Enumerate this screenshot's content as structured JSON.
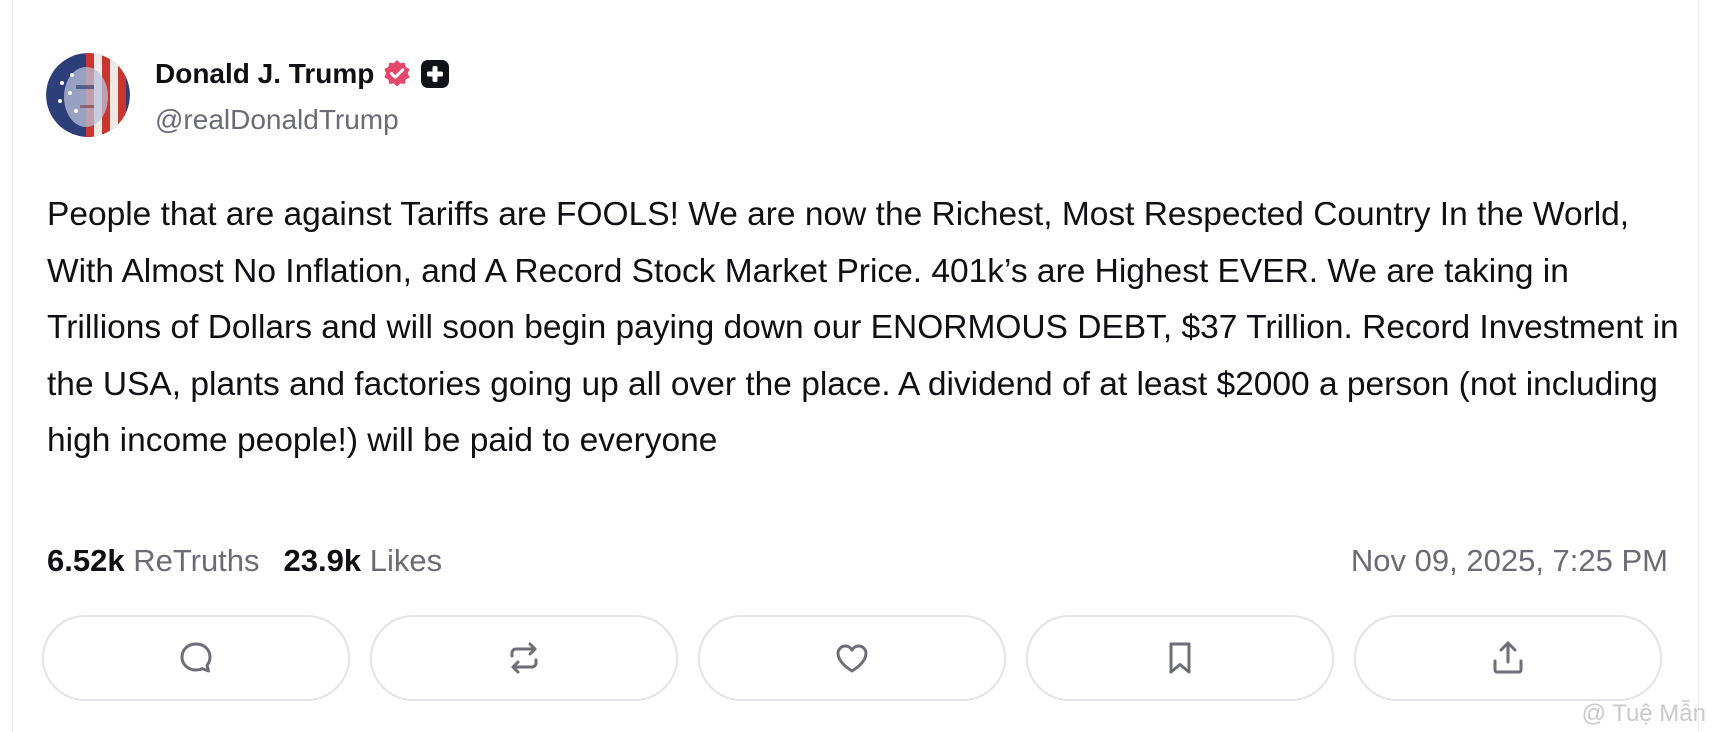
{
  "author": {
    "display_name": "Donald J. Trump",
    "handle": "@realDonaldTrump",
    "avatar_icon": "avatar-image",
    "verified_color": "#e5476b"
  },
  "post": {
    "text": "People that are against Tariffs are FOOLS! We are now the Richest, Most Respected Country In the World, With Almost No Inflation, and A Record Stock Market Price. 401k’s are Highest EVER. We are taking in Trillions of Dollars and will soon begin paying down our ENORMOUS DEBT, $37 Trillion. Record Investment in the USA, plants and factories going up all over the place. A dividend of at least $2000 a person (not including high income people!) will be paid to everyone"
  },
  "stats": {
    "retruths_count": "6.52k",
    "retruths_label": "ReTruths",
    "likes_count": "23.9k",
    "likes_label": "Likes"
  },
  "timestamp": "Nov 09, 2025, 7:25 PM",
  "actions": [
    {
      "name": "reply",
      "icon": "comment-icon"
    },
    {
      "name": "retruth",
      "icon": "repost-icon"
    },
    {
      "name": "like",
      "icon": "heart-icon"
    },
    {
      "name": "bookmark",
      "icon": "bookmark-icon"
    },
    {
      "name": "share",
      "icon": "share-icon"
    }
  ],
  "watermark": "@ Tuệ Mẫn"
}
